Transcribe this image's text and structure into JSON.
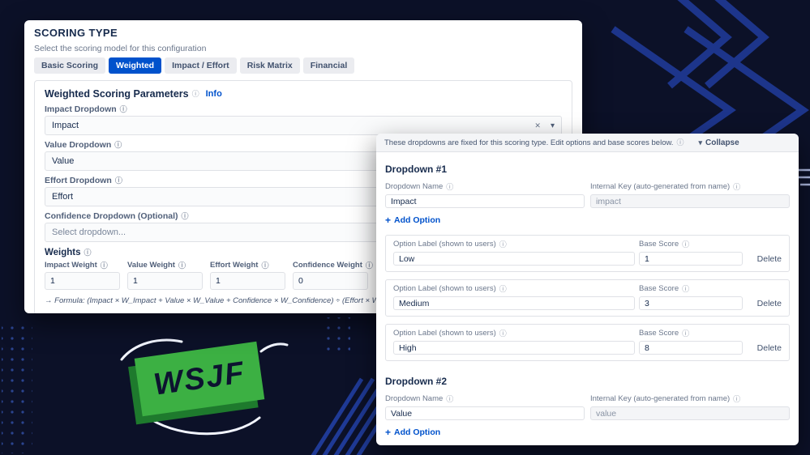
{
  "app": {
    "wsjf_badge": "WSJF"
  },
  "icons": {
    "info": "ⓘ",
    "clear": "✕",
    "chevron_down": "▾",
    "collapse": "▾",
    "plus": "+"
  },
  "scoring": {
    "title": "SCORING TYPE",
    "subtitle": "Select the scoring model for this configuration",
    "tabs": [
      {
        "label": "Basic Scoring"
      },
      {
        "label": "Weighted"
      },
      {
        "label": "Impact / Effort"
      },
      {
        "label": "Risk Matrix"
      },
      {
        "label": "Financial"
      }
    ],
    "active_tab": "Weighted",
    "section_heading": "Weighted Scoring Parameters",
    "info_link": "Info",
    "impact_dropdown": {
      "label": "Impact Dropdown",
      "value": "Impact"
    },
    "value_dropdown": {
      "label": "Value Dropdown",
      "value": "Value"
    },
    "effort_dropdown": {
      "label": "Effort Dropdown",
      "value": "Effort"
    },
    "confidence_dropdown": {
      "label": "Confidence Dropdown (Optional)",
      "placeholder": "Select dropdown..."
    },
    "weights": {
      "heading": "Weights",
      "impact": {
        "label": "Impact Weight",
        "value": "1"
      },
      "value": {
        "label": "Value Weight",
        "value": "1"
      },
      "effort": {
        "label": "Effort Weight",
        "value": "1"
      },
      "confidence": {
        "label": "Confidence Weight",
        "value": "0"
      }
    },
    "formula": "→ Formula: (Impact × W_Impact + Value × W_Value + Confidence × W_Confidence) ÷ (Effort × W_Effort)"
  },
  "options_editor": {
    "banner_text": "These dropdowns are fixed for this scoring type. Edit options and base scores below.",
    "collapse_label": "Collapse",
    "name_label": "Dropdown Name",
    "key_label": "Internal Key (auto-generated from name)",
    "add_option_label": "Add Option",
    "option_label_header": "Option Label (shown to users)",
    "base_score_header": "Base Score",
    "delete_label": "Delete",
    "dropdowns": [
      {
        "heading": "Dropdown #1",
        "name": "Impact",
        "key": "impact",
        "options": [
          {
            "label": "Low",
            "score": "1"
          },
          {
            "label": "Medium",
            "score": "3"
          },
          {
            "label": "High",
            "score": "8"
          }
        ]
      },
      {
        "heading": "Dropdown #2",
        "name": "Value",
        "key": "value",
        "options": []
      }
    ]
  }
}
